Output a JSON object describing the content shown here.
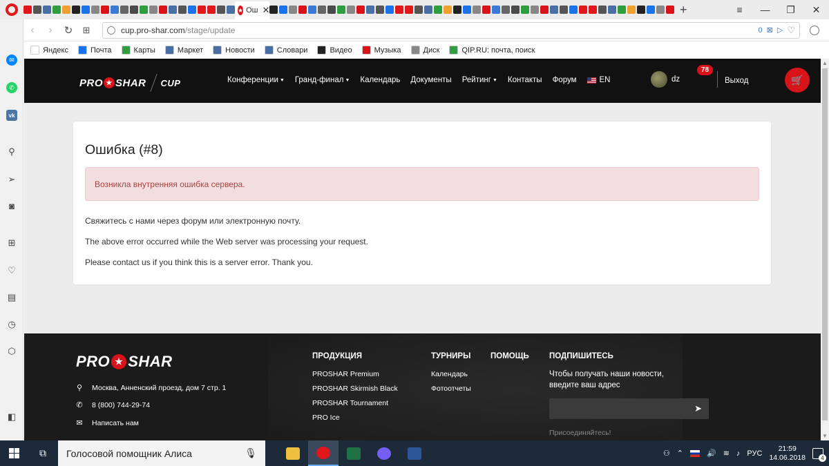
{
  "browser": {
    "active_tab_title": "Ош",
    "url_host": "cup.pro-shar.com",
    "url_path": "/stage/update",
    "adblock_count": "0",
    "bookmarks": [
      {
        "label": "Яндекс",
        "color": "#ffffff"
      },
      {
        "label": "Почта",
        "color": "#1a73e8"
      },
      {
        "label": "Карты",
        "color": "#2e9e3e"
      },
      {
        "label": "Маркет",
        "color": "#4a6fa5"
      },
      {
        "label": "Новости",
        "color": "#4a6fa5"
      },
      {
        "label": "Словари",
        "color": "#4a6fa5"
      },
      {
        "label": "Видео",
        "color": "#222222"
      },
      {
        "label": "Музыка",
        "color": "#d8141a"
      },
      {
        "label": "Диск",
        "color": "#888888"
      },
      {
        "label": "QIP.RU: почта, поиск",
        "color": "#2e9e3e"
      }
    ]
  },
  "site": {
    "logo_text_left": "PRO",
    "logo_text_right": "SHAR",
    "logo_cup": "CUP",
    "nav": [
      {
        "label": "Конференции",
        "caret": true
      },
      {
        "label": "Гранд-финал",
        "caret": true
      },
      {
        "label": "Календарь",
        "caret": false
      },
      {
        "label": "Документы",
        "caret": false
      },
      {
        "label": "Рейтинг",
        "caret": true
      },
      {
        "label": "Контакты",
        "caret": false
      },
      {
        "label": "Форум",
        "caret": false
      }
    ],
    "language": "EN",
    "username": "dz",
    "notifications": "78",
    "logout": "Выход",
    "accent_color": "#d8141a"
  },
  "error": {
    "title": "Ошибка (#8)",
    "alert": "Возникла внутренняя ошибка сервера.",
    "line1": "Свяжитесь с нами через форум или электронную почту.",
    "line2": "The above error occurred while the Web server was processing your request.",
    "line3": "Please contact us if you think this is a server error. Thank you."
  },
  "footer": {
    "address": "Москва, Анненский проезд, дом 7 стр. 1",
    "phone": "8 (800) 744-29-74",
    "write_us": "Написать нам",
    "products_title": "ПРОДУКЦИЯ",
    "products": [
      "PROSHAR Premium",
      "PROSHAR Skirmish Black",
      "PROSHAR Tournament",
      "PRO Ice"
    ],
    "tournaments_title": "ТУРНИРЫ",
    "tournaments": [
      "Календарь",
      "Фотоотчеты"
    ],
    "help_title": "ПОМОЩЬ",
    "subscribe_title": "ПОДПИШИТЕСЬ",
    "subscribe_text": "Чтобы получать наши новости, введите ваш адрес",
    "join": "Присоединяйтесь!"
  },
  "taskbar": {
    "search_placeholder": "Голосовой помощник Алиса",
    "lang": "РУС",
    "time": "21:59",
    "date": "14.06.2018",
    "notifications": "4"
  }
}
